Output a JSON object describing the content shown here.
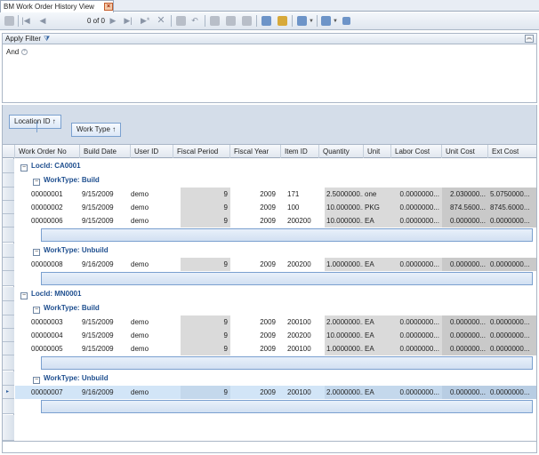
{
  "tab": {
    "title": "BM Work Order History View",
    "close_glyph": "×"
  },
  "toolbar": {
    "record_position": "0 of 0",
    "icons": [
      "save-icon",
      "first-record-icon",
      "previous-record-icon",
      "next-record-icon",
      "last-record-icon",
      "new-record-icon",
      "delete-icon",
      "edit-icon",
      "undo-icon",
      "print-preview-icon",
      "refresh-icon",
      "email-icon",
      "copy-icon",
      "paste-icon",
      "export-icon",
      "chart-icon",
      "settings-icon"
    ]
  },
  "filter": {
    "title": "Apply Filter",
    "operator": "And"
  },
  "group_by": {
    "chips": [
      "Location ID ↑",
      "Work Type ↑"
    ]
  },
  "columns": [
    "Work Order No",
    "Build Date",
    "User ID",
    "Fiscal Period",
    "Fiscal Year",
    "Item ID",
    "Quantity",
    "Unit",
    "Labor Cost",
    "Unit Cost",
    "Ext Cost"
  ],
  "groups": [
    {
      "label": "LocId: CA0001",
      "subgroups": [
        {
          "label": "WorkType: Build",
          "rows": [
            [
              "00000001",
              "9/15/2009",
              "demo",
              "9",
              "2009",
              "171",
              "2.5000000...",
              "one",
              "0.0000000...",
              "2.030000...",
              "5.0750000..."
            ],
            [
              "00000002",
              "9/15/2009",
              "demo",
              "9",
              "2009",
              "100",
              "10.000000...",
              "PKG",
              "0.0000000...",
              "874.5600...",
              "8745.6000..."
            ],
            [
              "00000006",
              "9/15/2009",
              "demo",
              "9",
              "2009",
              "200200",
              "10.000000...",
              "EA",
              "0.0000000...",
              "0.000000...",
              "0.0000000..."
            ]
          ]
        },
        {
          "label": "WorkType: Unbuild",
          "rows": [
            [
              "00000008",
              "9/16/2009",
              "demo",
              "9",
              "2009",
              "200200",
              "1.0000000...",
              "EA",
              "0.0000000...",
              "0.000000...",
              "0.0000000..."
            ]
          ]
        }
      ]
    },
    {
      "label": "LocId: MN0001",
      "subgroups": [
        {
          "label": "WorkType: Build",
          "rows": [
            [
              "00000003",
              "9/15/2009",
              "demo",
              "9",
              "2009",
              "200100",
              "2.0000000...",
              "EA",
              "0.0000000...",
              "0.000000...",
              "0.0000000..."
            ],
            [
              "00000004",
              "9/15/2009",
              "demo",
              "9",
              "2009",
              "200200",
              "10.000000...",
              "EA",
              "0.0000000...",
              "0.000000...",
              "0.0000000..."
            ],
            [
              "00000005",
              "9/15/2009",
              "demo",
              "9",
              "2009",
              "200100",
              "1.0000000...",
              "EA",
              "0.0000000...",
              "0.000000...",
              "0.0000000..."
            ]
          ]
        },
        {
          "label": "WorkType: Unbuild",
          "rows": [
            [
              "00000007",
              "9/16/2009",
              "demo",
              "9",
              "2009",
              "200100",
              "2.0000000...",
              "EA",
              "0.0000000...",
              "0.000000...",
              "0.0000000..."
            ]
          ]
        }
      ]
    }
  ],
  "selected_row": "00000007"
}
